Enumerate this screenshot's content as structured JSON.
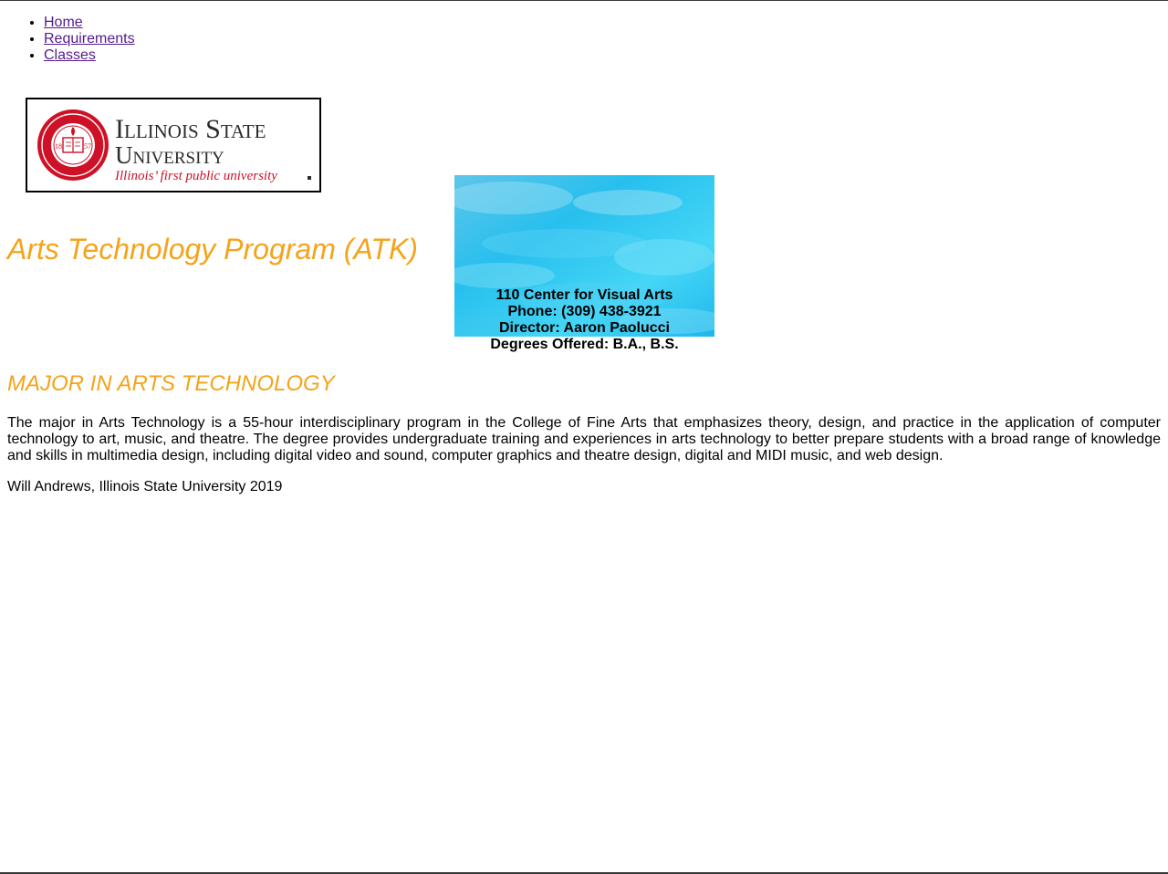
{
  "nav": {
    "items": [
      {
        "label": "Home"
      },
      {
        "label": "Requirements"
      },
      {
        "label": "Classes"
      }
    ]
  },
  "logo": {
    "line1": "Illinois State",
    "line2": "University",
    "tagline": "Illinois’ first public university",
    "seal_year_left": "18",
    "seal_year_right": "57",
    "brand_color": "#ce1126"
  },
  "title": "Arts Technology Program (ATK)",
  "info": {
    "location": "110 Center for Visual Arts",
    "phone": "Phone: (309) 438-3921",
    "director": "Director: Aaron Paolucci",
    "degrees": "Degrees Offered: B.A., B.S."
  },
  "major": {
    "heading": "MAJOR IN ARTS TECHNOLOGY",
    "description": "The major in Arts Technology is a 55-hour interdisciplinary program in the College of Fine Arts that emphasizes theory, design, and practice in the application of computer technology to art, music, and theatre. The degree provides undergraduate training and experiences in arts technology to better prepare students with a broad range of knowledge and skills in multimedia design, including digital video and sound, computer graphics and theatre design, digital and MIDI music, and web design."
  },
  "footer": "Will Andrews, Illinois State University 2019",
  "colors": {
    "accent": "#f5a31a",
    "link": "#551a8b",
    "water": "#2ec6ef"
  }
}
